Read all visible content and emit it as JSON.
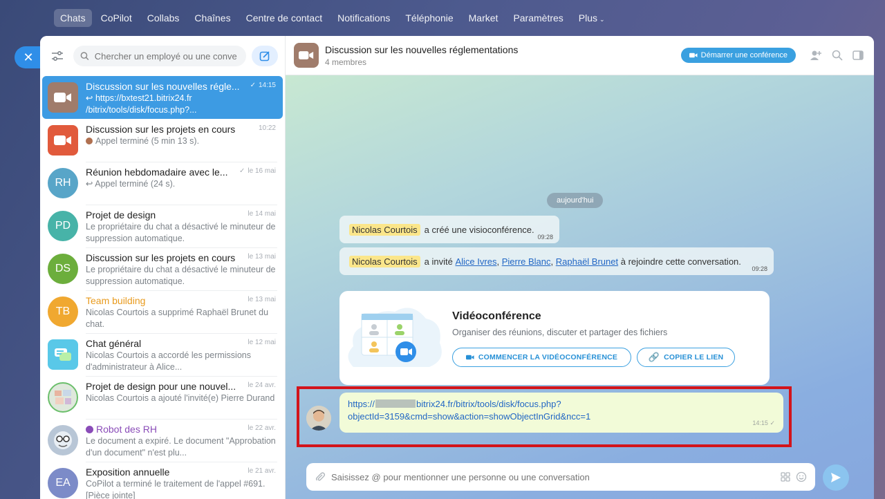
{
  "topnav": {
    "items": [
      "Chats",
      "CoPilot",
      "Collabs",
      "Chaînes",
      "Centre de contact",
      "Notifications",
      "Téléphonie",
      "Market",
      "Paramètres",
      "Plus"
    ]
  },
  "sidebar": {
    "search_placeholder": "Chercher un employé ou une conve",
    "chats": [
      {
        "title": "Discussion sur les nouvelles régle...",
        "time": "14:15",
        "sub": "↩ https://bxtest21.bitrix24.fr /bitrix/tools/disk/focus.php?...",
        "avatar_text": "",
        "avatar_color": "#a07c6b"
      },
      {
        "title": "Discussion sur les projets en cours",
        "time": "10:22",
        "sub": "Appel terminé (5 min 13 s).",
        "avatar_text": "",
        "avatar_color": "#e15a3c"
      },
      {
        "title": "Réunion hebdomadaire avec le...",
        "time": "le 16 mai",
        "sub": "↩ Appel terminé (24 s).",
        "avatar_text": "RH",
        "avatar_color": "#58a5c8"
      },
      {
        "title": "Projet de design",
        "time": "le 14 mai",
        "sub": "Le propriétaire du chat a désactivé le minuteur de suppression automatique.",
        "avatar_text": "PD",
        "avatar_color": "#47b3a8"
      },
      {
        "title": "Discussion sur les projets en cours",
        "time": "le 13 mai",
        "sub": "Le propriétaire du chat a désactivé le minuteur de suppression automatique.",
        "avatar_text": "DS",
        "avatar_color": "#6cae3c"
      },
      {
        "title": "Team building",
        "time": "le 13 mai",
        "sub": "Nicolas Courtois a supprimé Raphaël Brunet du chat.",
        "avatar_text": "TB",
        "avatar_color": "#f0a830"
      },
      {
        "title": "Chat général",
        "time": "le 12 mai",
        "sub": "Nicolas Courtois a accordé les permissions d'administrateur à Alice...",
        "avatar_text": "",
        "avatar_color": "#59c8e8"
      },
      {
        "title": "Projet de design pour une nouvel...",
        "time": "le 24 avr.",
        "sub": "Nicolas Courtois a ajouté l'invité(e) Pierre Durand",
        "avatar_text": "",
        "avatar_color": "#dfe8dc"
      },
      {
        "title": "Robot des RH",
        "time": "le 22 avr.",
        "sub": "Le document a expiré. Le document \"Approbation d'un document\" n'est plu...",
        "avatar_text": "",
        "avatar_color": "#b8c6d6"
      },
      {
        "title": "Exposition annuelle",
        "time": "le 21 avr.",
        "sub": "CoPilot a terminé le traitement de l'appel #691. [Pièce jointe]",
        "avatar_text": "EA",
        "avatar_color": "#7c8bc8"
      }
    ]
  },
  "main": {
    "title": "Discussion sur les nouvelles réglementations",
    "members": "4 membres",
    "conf_button": "Démarrer une conférence",
    "date_pill": "aujourd'hui",
    "sys1": {
      "name": "Nicolas Courtois",
      "text": "a créé une visioconférence.",
      "time": "09:28"
    },
    "sys2": {
      "name": "Nicolas Courtois",
      "pre": "a invité",
      "p1": "Alice Ivres",
      "p2": "Pierre Blanc",
      "p3": "Raphaël Brunet",
      "post": "à rejoindre cette conversation.",
      "time": "09:28",
      "sep": ","
    },
    "card": {
      "title": "Vidéoconférence",
      "desc": "Organiser des réunions, discuter et partager des fichiers",
      "btn_start": "COMMENCER LA VIDÉOCONFÉRENCE",
      "btn_copy": "COPIER LE LIEN"
    },
    "message": {
      "link_a": "https://",
      "link_b": "bitrix24.fr/bitrix/tools/disk/focus.php?",
      "link_c": "objectId=3159&cmd=show&action=showObjectInGrid&ncc=1",
      "time": "14:15"
    },
    "composer_placeholder": "Saisissez @ pour mentionner une personne ou une conversation"
  }
}
